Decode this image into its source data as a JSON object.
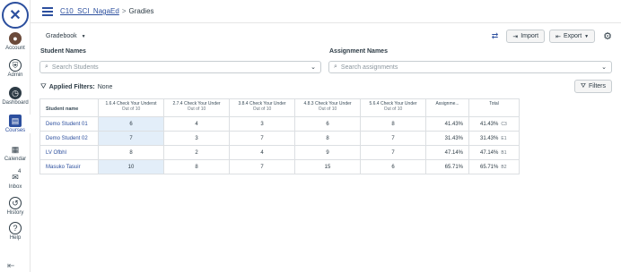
{
  "nav": {
    "items": [
      {
        "label": "Account"
      },
      {
        "label": "Admin"
      },
      {
        "label": "Dashboard"
      },
      {
        "label": "Courses"
      },
      {
        "label": "Calendar"
      },
      {
        "label": "Inbox",
        "badge": "4"
      },
      {
        "label": "History"
      },
      {
        "label": "Help"
      }
    ]
  },
  "header": {
    "course": "C10_SCI_NagaEd",
    "separator": ">",
    "page": "Gradies"
  },
  "toolbar": {
    "gradebook_label": "Gradebook",
    "import_label": "Import",
    "export_label": "Export"
  },
  "search": {
    "students_label": "Student Names",
    "students_placeholder": "Search Students",
    "assignments_label": "Assignment Names",
    "assignments_placeholder": "Search assignments"
  },
  "filters": {
    "applied_label": "Applied Filters:",
    "applied_value": "None",
    "button_label": "Filters"
  },
  "grid": {
    "student_header": "Student name",
    "columns": [
      {
        "title": "1.6.4 Check Your Underst",
        "sub": "Out of 10"
      },
      {
        "title": "2.7.4 Check Your Under",
        "sub": "Out of 10"
      },
      {
        "title": "3.8.4 Check Your Under",
        "sub": "Out of 10"
      },
      {
        "title": "4.8.3 Check Your Under",
        "sub": "Out of 10"
      },
      {
        "title": "5.6.4 Check Your Under",
        "sub": "Out of 10"
      },
      {
        "title": "Assignme...",
        "sub": ""
      },
      {
        "title": "Total",
        "sub": ""
      }
    ],
    "rows": [
      {
        "name": "Demo Student 01",
        "scores": [
          "6",
          "4",
          "3",
          "6",
          "8"
        ],
        "assign": "41.43%",
        "total": "41.43%",
        "letter": "C3"
      },
      {
        "name": "Demo Student 02",
        "scores": [
          "7",
          "3",
          "7",
          "8",
          "7"
        ],
        "assign": "31.43%",
        "total": "31.43%",
        "letter": "E1"
      },
      {
        "name": "LV Ofbhl",
        "scores": [
          "8",
          "2",
          "4",
          "9",
          "7"
        ],
        "assign": "47.14%",
        "total": "47.14%",
        "letter": "B1"
      },
      {
        "name": "Masuko Tasuir",
        "scores": [
          "10",
          "8",
          "7",
          "15",
          "6"
        ],
        "assign": "65.71%",
        "total": "65.71%",
        "letter": "B2"
      }
    ]
  }
}
